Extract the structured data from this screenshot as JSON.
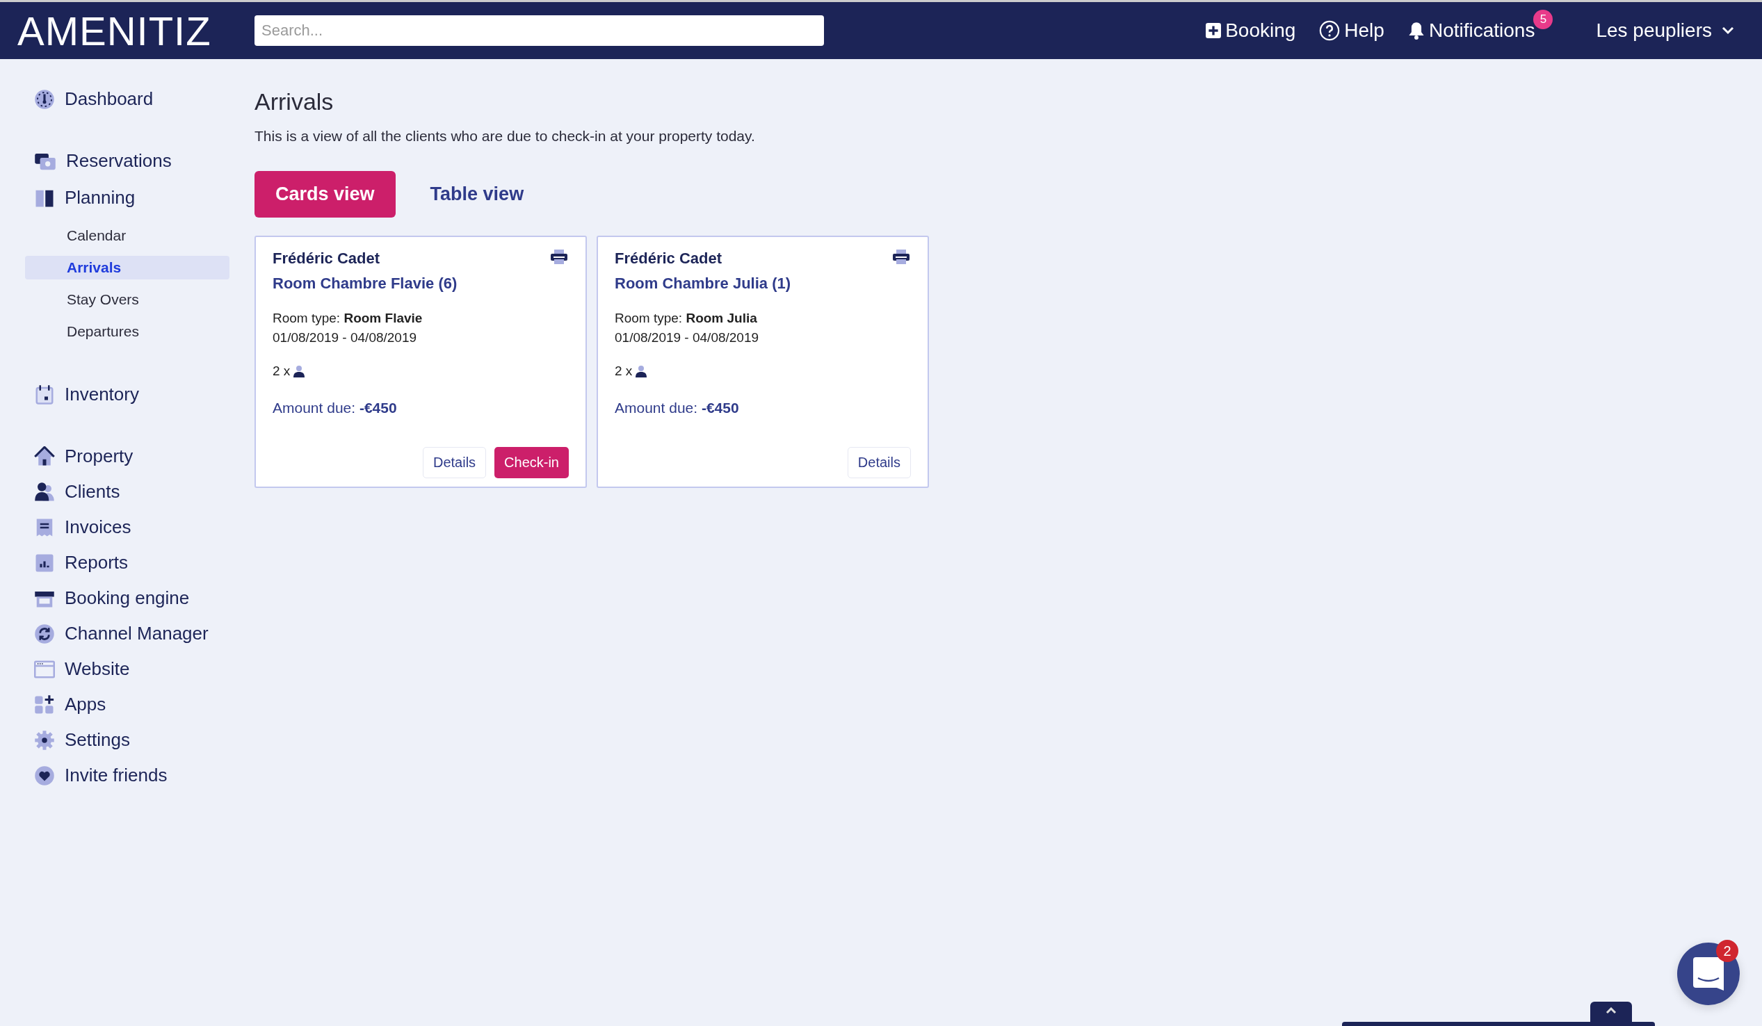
{
  "header": {
    "logo": "AMENITIZ",
    "search": {
      "placeholder": "Search..."
    },
    "actions": [
      {
        "kind": "booking",
        "label": "Booking"
      },
      {
        "kind": "help",
        "label": "Help"
      },
      {
        "kind": "notifications",
        "label": "Notifications",
        "badge": "5"
      }
    ],
    "account": "Les peupliers"
  },
  "sidebar": {
    "groups": [
      [
        {
          "label": "Dashboard",
          "selected": false
        }
      ],
      [
        {
          "label": "Reservations",
          "selected": false
        },
        {
          "label": "Planning",
          "selected": false,
          "children": [
            {
              "label": "Calendar",
              "selected": false
            },
            {
              "label": "Arrivals",
              "selected": true
            },
            {
              "label": "Stay Overs",
              "selected": false
            },
            {
              "label": "Departures",
              "selected": false
            }
          ]
        }
      ],
      [
        {
          "label": "Inventory",
          "selected": false
        }
      ],
      [
        {
          "label": "Property",
          "selected": false
        },
        {
          "label": "Clients",
          "selected": false
        },
        {
          "label": "Invoices",
          "selected": false
        },
        {
          "label": "Reports",
          "selected": false
        },
        {
          "label": "Booking engine",
          "selected": false
        },
        {
          "label": "Channel Manager",
          "selected": false
        },
        {
          "label": "Website",
          "selected": false
        },
        {
          "label": "Apps",
          "selected": false
        },
        {
          "label": "Settings",
          "selected": false
        },
        {
          "label": "Invite friends",
          "selected": false
        }
      ]
    ]
  },
  "page": {
    "title": "Arrivals",
    "description": "This is a view of all the clients who are due to check-in at your property today.",
    "tabs": [
      {
        "label": "Cards view",
        "selected": true
      },
      {
        "label": "Table view",
        "selected": false
      }
    ],
    "cards": [
      {
        "guest": "Frédéric Cadet",
        "room": "Room Chambre Flavie (6)",
        "room_type": "Room type: **Room Flavie**",
        "dates": "01/08/2019 - 04/08/2019",
        "guests": "2 x",
        "amount": "Amount due: **-€450**",
        "buttons": [
          {
            "kind": "details",
            "label": "Details"
          },
          {
            "kind": "checkin",
            "label": "Check-in"
          }
        ]
      },
      {
        "guest": "Frédéric Cadet",
        "room": "Room Chambre Julia (1)",
        "room_type": "Room type: **Room Julia**",
        "dates": "01/08/2019 - 04/08/2019",
        "guests": "2 x",
        "amount": "Amount due: **-€450**",
        "buttons": [
          {
            "kind": "details",
            "label": "Details"
          }
        ]
      }
    ]
  },
  "chat": {
    "badge": "2"
  }
}
